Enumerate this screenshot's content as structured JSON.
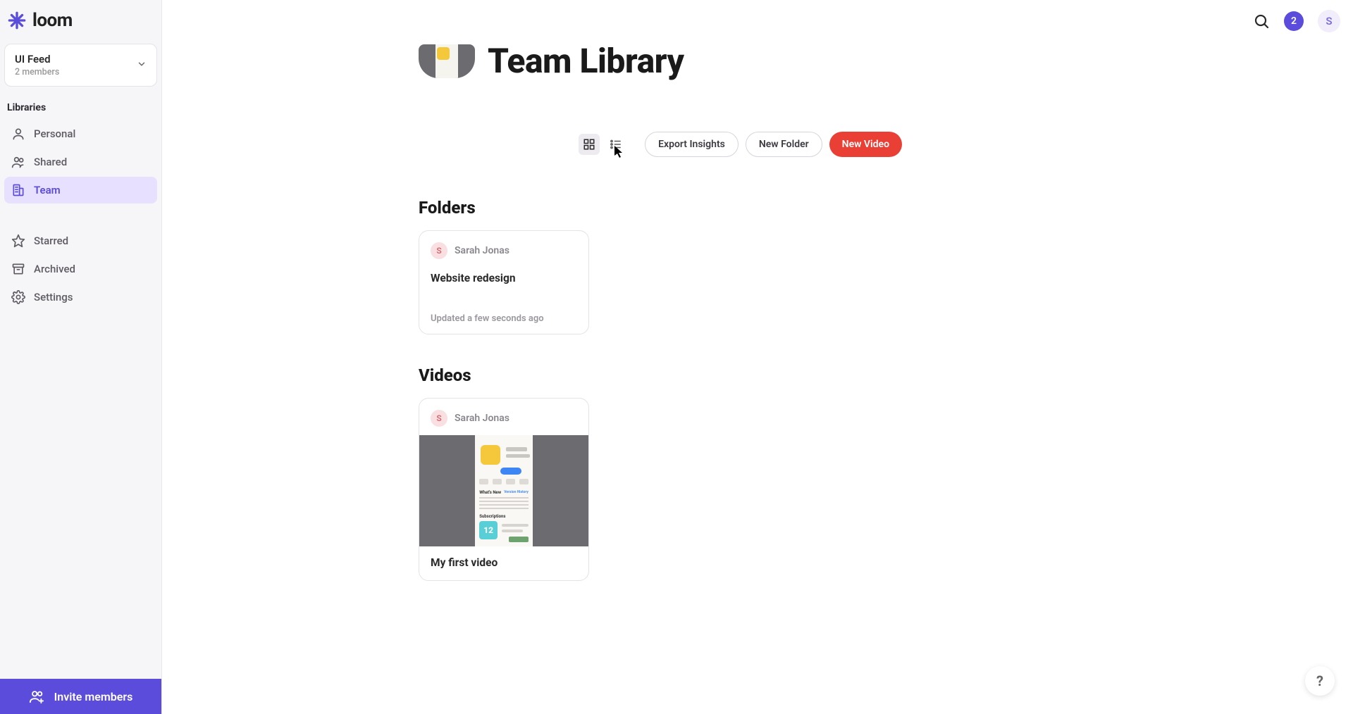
{
  "brand": {
    "name": "loom"
  },
  "workspace": {
    "name": "UI Feed",
    "members_label": "2 members"
  },
  "sidebar": {
    "section_label": "Libraries",
    "items": [
      {
        "label": "Personal"
      },
      {
        "label": "Shared"
      },
      {
        "label": "Team"
      },
      {
        "label": "Starred"
      },
      {
        "label": "Archived"
      },
      {
        "label": "Settings"
      }
    ],
    "invite_label": "Invite members"
  },
  "header": {
    "notifications_count": "2",
    "avatar_initial": "S"
  },
  "page": {
    "title": "Team Library"
  },
  "toolbar": {
    "export_label": "Export Insights",
    "new_folder_label": "New Folder",
    "new_video_label": "New Video"
  },
  "folders": {
    "title": "Folders",
    "items": [
      {
        "owner_initial": "S",
        "owner_name": "Sarah Jonas",
        "name": "Website redesign",
        "updated": "Updated a few seconds ago"
      }
    ]
  },
  "videos": {
    "title": "Videos",
    "items": [
      {
        "owner_initial": "S",
        "owner_name": "Sarah Jonas",
        "title": "My first video"
      }
    ]
  },
  "help": {
    "label": "?"
  }
}
